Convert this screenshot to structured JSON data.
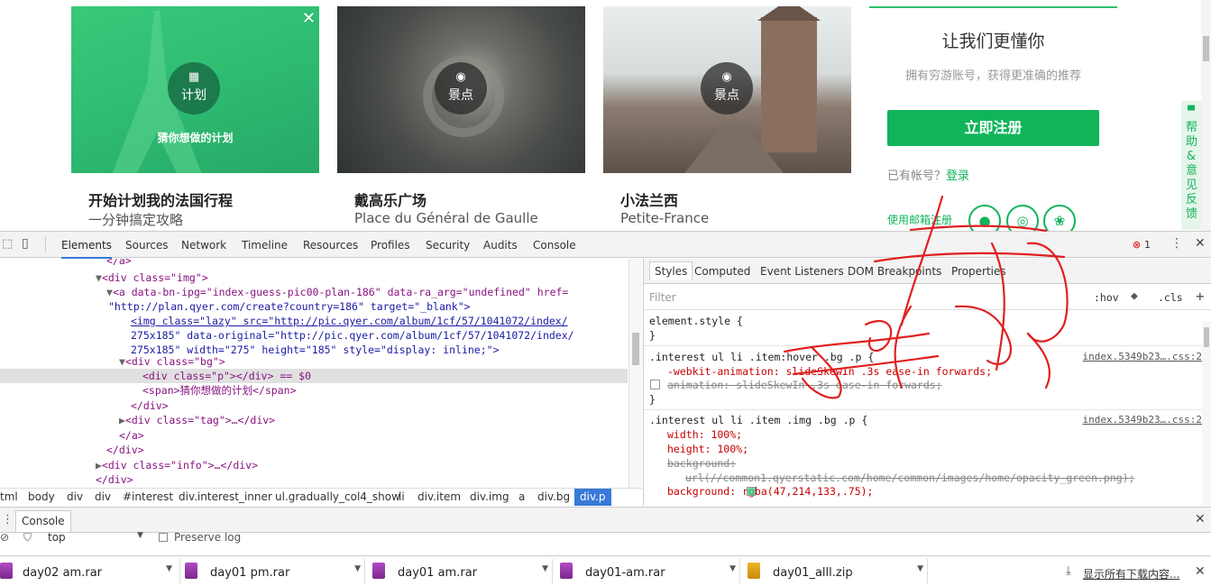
{
  "cards": [
    {
      "badge": "计划",
      "caption": "猜你想做的计划",
      "title": "开始计划我的法国行程",
      "subtitle": "一分钟搞定攻略"
    },
    {
      "badge": "景点",
      "title": "戴高乐广场",
      "subtitle": "Place du Général de Gaulle"
    },
    {
      "badge": "景点",
      "title": "小法兰西",
      "subtitle": "Petite-France"
    }
  ],
  "register": {
    "heading": "让我们更懂你",
    "subheading": "拥有穷游账号，获得更准确的推荐",
    "button": "立即注册",
    "have_account": "已有帐号？",
    "login": "登录",
    "email_register": "使用邮箱注册"
  },
  "help_tab": "帮助&意见反馈",
  "devtools": {
    "tabs": [
      "Elements",
      "Sources",
      "Network",
      "Timeline",
      "Resources",
      "Profiles",
      "Security",
      "Audits",
      "Console"
    ],
    "error_count": "1",
    "styles_tabs": [
      "Styles",
      "Computed",
      "Event Listeners",
      "DOM Breakpoints",
      "Properties"
    ],
    "filter_placeholder": "Filter",
    "hov": ":hov",
    "cls": ".cls",
    "breadcrumbs": [
      "tml",
      "body",
      "div",
      "div",
      "#interest",
      "div.interest_inner",
      "ul.gradually_col4_show",
      "li",
      "div.item",
      "div.img",
      "a",
      "div.bg",
      "div.p"
    ],
    "console_label": "Console",
    "console_context": "top",
    "preserve_log": "Preserve log"
  },
  "dom_lines": [
    "</a>",
    "<div class=\"img\">",
    "<a data-bn-ipg=\"index-guess-pic00-plan-186\" data-ra_arg=\"undefined\" href=",
    "\"http://plan.qyer.com/create?country=186\" target=\"_blank\">",
    "<img class=\"lazy\" src=\"http://pic.qyer.com/album/1cf/57/1041072/index/",
    "275x185\" data-original=\"http://pic.qyer.com/album/1cf/57/1041072/index/",
    "275x185\" width=\"275\" height=\"185\" style=\"display: inline;\">",
    "<div class=\"bg\">",
    "<div class=\"p\"></div> == $0",
    "<span>猜你想做的计划</span>",
    "</div>",
    "<div class=\"tag\">…</div>",
    "</a>",
    "</div>",
    "<div class=\"info\">…</div>",
    "</div>"
  ],
  "style_rules": {
    "element_style": "element.style {",
    "r1_selector": ".interest ul li .item:hover .bg .p {",
    "r1_src": "index.5349b23….css:2",
    "r1_p1": "-webkit-animation: slideSkewIn .3s ease-in forwards;",
    "r1_p2": "animation: slideSkewIn .3s ease-in forwards;",
    "r2_selector": ".interest ul li .item .img .bg .p {",
    "r2_src": "index.5349b23….css:2",
    "r2_p1": "width: 100%;",
    "r2_p2": "height: 100%;",
    "r2_p3": "background:",
    "r2_p3b": "url(//common1.qyerstatic.com/home/common/images/home/opacity_green.png);",
    "r2_p4": "background: rgba(47,214,133,.75);",
    "close_brace": "}"
  },
  "downloads": [
    {
      "name": "day02 am.rar"
    },
    {
      "name": "day01 pm.rar"
    },
    {
      "name": "day01 am.rar"
    },
    {
      "name": "day01-am.rar"
    },
    {
      "name": "day01_alll.zip"
    }
  ],
  "show_all": "显示所有下载内容...",
  "colors": {
    "accent": "#10b55a",
    "devtools_blue": "#3879d9",
    "annotation": "#e02020"
  }
}
